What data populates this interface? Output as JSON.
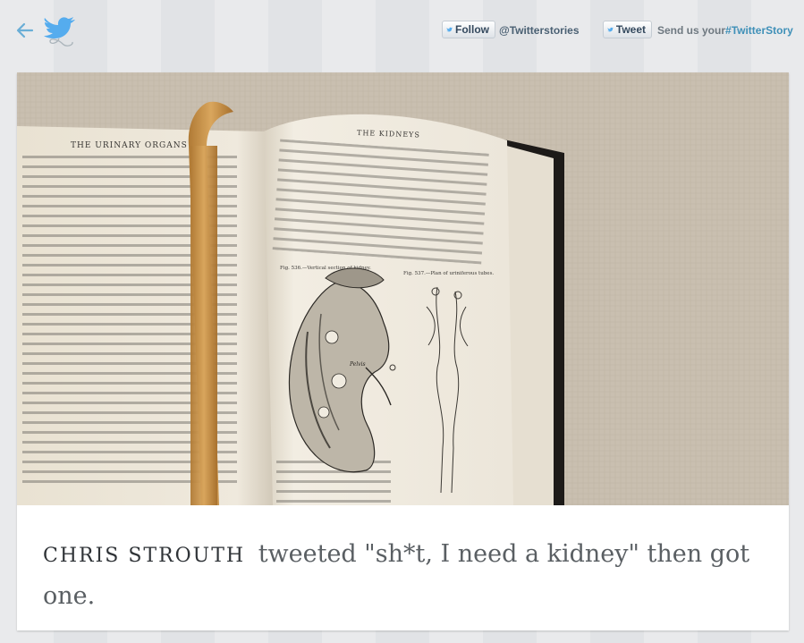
{
  "header": {
    "back_icon": "back-arrow-icon",
    "logo_icon": "twitter-bird-icon",
    "follow_label": "Follow",
    "handle": "@Twitterstories",
    "tweet_label": "Tweet",
    "send_prefix": "Send us your",
    "send_hashtag": "#TwitterStory"
  },
  "story": {
    "image_alt": "Open anatomy book showing a vertical section of a kidney with a ribbon bookmark",
    "book_left_heading": "THE URINARY ORGANS",
    "book_right_heading": "THE KIDNEYS",
    "figure_left_caption": "Fig. 536.—Vertical section of kidney.",
    "figure_right_caption": "Fig. 537.—Plan of uriniferous tubes.",
    "figure_label": "Pelvis",
    "author": "CHRIS STROUTH",
    "text": "tweeted \"sh*t, I need a kidney\" then got one."
  },
  "colors": {
    "brand_blue": "#55acee",
    "caption_text": "#5a5f63",
    "author_text": "#2f3337",
    "hashtag": "#3f90b8"
  }
}
